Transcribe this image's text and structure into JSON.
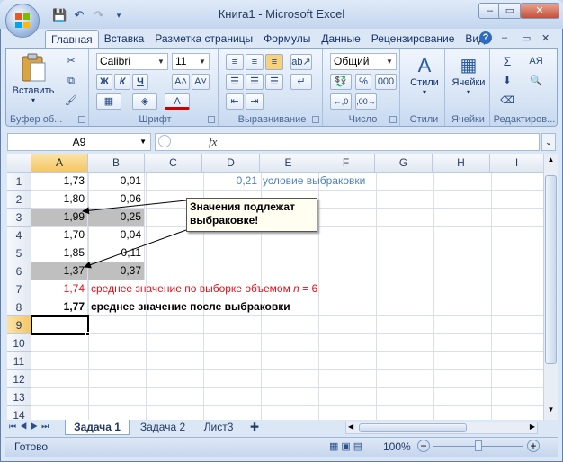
{
  "window": {
    "title": "Книга1 - Microsoft Excel",
    "minimize": "–",
    "restore": "▭",
    "close": "✕"
  },
  "ribbon_tabs": [
    "Главная",
    "Вставка",
    "Разметка страницы",
    "Формулы",
    "Данные",
    "Рецензирование",
    "Вид"
  ],
  "groups": {
    "clipboard": {
      "label": "Буфер об...",
      "paste": "Вставить"
    },
    "font": {
      "label": "Шрифт",
      "family": "Calibri",
      "size": "11",
      "bold": "Ж",
      "italic": "К",
      "underline": "Ч"
    },
    "alignment": {
      "label": "Выравнивание"
    },
    "number": {
      "label": "Число",
      "format": "Общий",
      "percent": "%",
      "thousands": "000"
    },
    "styles": {
      "label": "Стили"
    },
    "cells": {
      "label": "Ячейки"
    },
    "editing": {
      "label": "Редактиров..."
    }
  },
  "formula_bar": {
    "name_box": "A9",
    "fx": "fx",
    "content": ""
  },
  "columns": [
    "A",
    "B",
    "C",
    "D",
    "E",
    "F",
    "G",
    "H",
    "I"
  ],
  "rows": [
    "1",
    "2",
    "3",
    "4",
    "5",
    "6",
    "7",
    "8",
    "9",
    "10",
    "11",
    "12",
    "13",
    "14"
  ],
  "cells": {
    "A1": "1,73",
    "B1": "0,01",
    "D1": "0,21",
    "E1": "условие выбраковки",
    "A2": "1,80",
    "B2": "0,06",
    "A3": "1,99",
    "B3": "0,25",
    "A4": "1,70",
    "B4": "0,04",
    "A5": "1,85",
    "B5": "0,11",
    "A6": "1,37",
    "B6": "0,37",
    "A7": "1,74",
    "B7": "среднее значение по выборке объемом ",
    "B7_var": "n",
    "B7_tail": " = 6",
    "A8": "1,77",
    "B8": "среднее значение после выбраковки"
  },
  "callout": {
    "line1": "Значения подлежат",
    "line2": "выбраковке!"
  },
  "sheets": [
    "Задача 1",
    "Задача 2",
    "Лист3"
  ],
  "status": {
    "ready": "Готово",
    "zoom": "100%"
  },
  "colors": {
    "blue_text": "#4f81bd",
    "red_text": "#e0101a",
    "gray_fill": "#bfbfbf"
  }
}
